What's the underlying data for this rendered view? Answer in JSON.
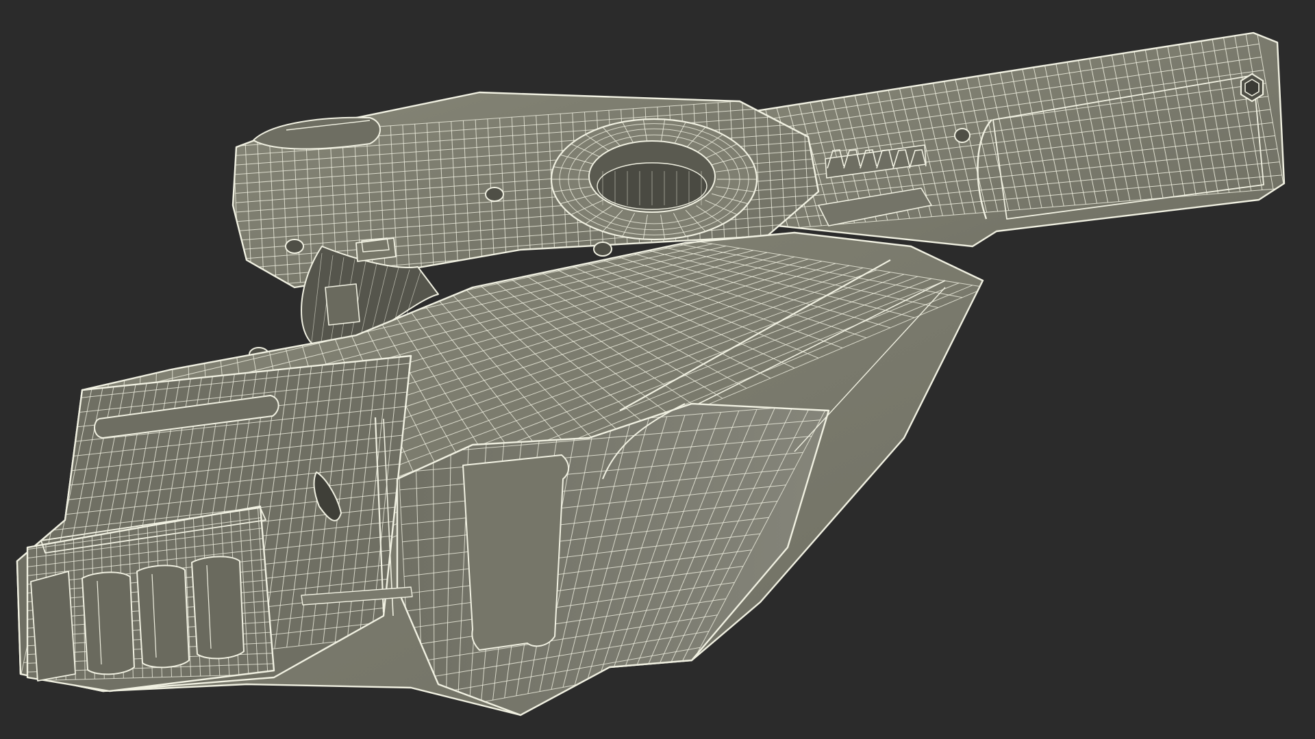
{
  "scene": {
    "subject": "wireframe-3d-model",
    "background_color": "#2b2b2b",
    "surface_color": "#7d7d6f",
    "surface_shade_color": "#6e6e62",
    "surface_dark_color": "#4f4f46",
    "wire_color": "#f1f1e2"
  }
}
